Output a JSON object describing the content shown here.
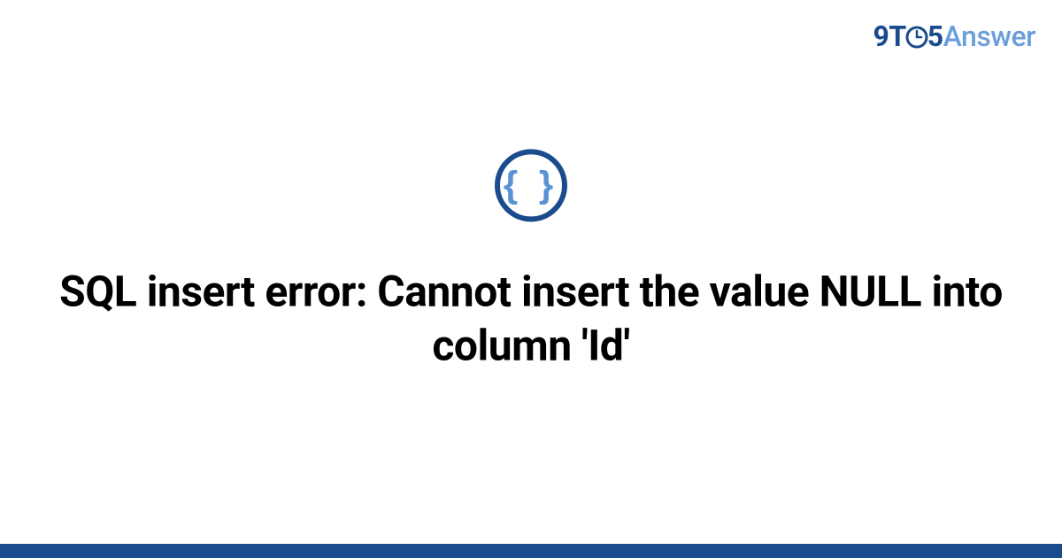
{
  "brand": {
    "nine": "9",
    "t": "T",
    "five": "5",
    "answer": "Answer"
  },
  "main": {
    "logo_glyph": "{ }",
    "title": "SQL insert error: Cannot insert the value NULL into column 'Id'"
  },
  "colors": {
    "brand_dark": "#1a4b8c",
    "brand_light": "#6b9edb"
  }
}
